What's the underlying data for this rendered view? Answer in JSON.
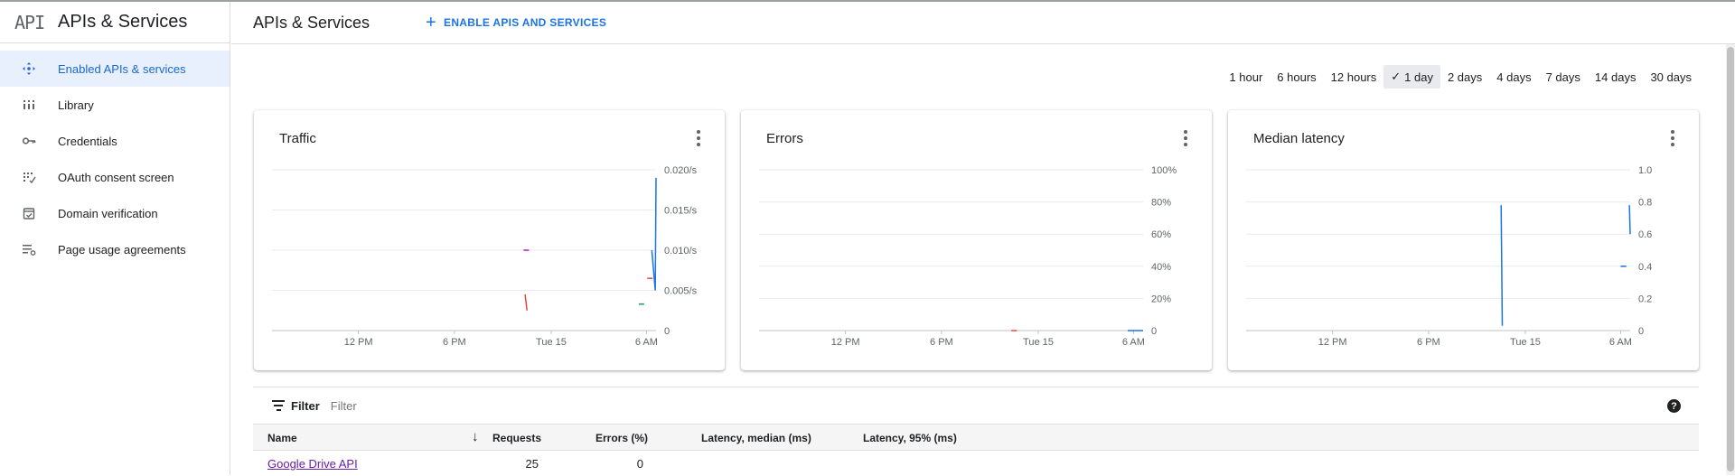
{
  "brand": {
    "logo": "API",
    "title": "APIs & Services"
  },
  "sidebar": {
    "items": [
      {
        "label": "Enabled APIs & services",
        "icon": "enabled-apis-icon",
        "active": true
      },
      {
        "label": "Library",
        "icon": "library-icon",
        "active": false
      },
      {
        "label": "Credentials",
        "icon": "key-icon",
        "active": false
      },
      {
        "label": "OAuth consent screen",
        "icon": "oauth-icon",
        "active": false
      },
      {
        "label": "Domain verification",
        "icon": "domain-check-icon",
        "active": false
      },
      {
        "label": "Page usage agreements",
        "icon": "settings-list-icon",
        "active": false
      }
    ]
  },
  "header": {
    "title": "APIs & Services",
    "enable_button": "ENABLE APIS AND SERVICES"
  },
  "time_range": {
    "options": [
      "1 hour",
      "6 hours",
      "12 hours",
      "1 day",
      "2 days",
      "4 days",
      "7 days",
      "14 days",
      "30 days"
    ],
    "selected": "1 day"
  },
  "cards": {
    "traffic": {
      "title": "Traffic"
    },
    "errors": {
      "title": "Errors"
    },
    "latency": {
      "title": "Median latency"
    }
  },
  "chart_data": [
    {
      "type": "line",
      "title": "Traffic",
      "categories": [
        "12 PM",
        "6 PM",
        "Tue 15",
        "6 AM"
      ],
      "y_ticks": [
        "0.020/s",
        "0.015/s",
        "0.010/s",
        "0.005/s",
        "0"
      ],
      "ylim": [
        0,
        0.02
      ],
      "grid": true,
      "series": [
        {
          "color": "#1a73e8",
          "points": [
            [
              0.989,
              0.01
            ],
            [
              0.998,
              0.005
            ],
            [
              1.0,
              0.019
            ]
          ]
        },
        {
          "color": "#ea4335",
          "points": [
            [
              0.659,
              0.0045
            ],
            [
              0.664,
              0.0025
            ]
          ]
        },
        {
          "color": "#ea4335",
          "points": [
            [
              0.984,
              0.0065
            ]
          ]
        },
        {
          "color": "#0f9d58",
          "points": [
            [
              0.962,
              0.0033
            ]
          ]
        },
        {
          "color": "#9c27b0",
          "points": [
            [
              0.662,
              0.01
            ]
          ]
        }
      ]
    },
    {
      "type": "line",
      "title": "Errors",
      "categories": [
        "12 PM",
        "6 PM",
        "Tue 15",
        "6 AM"
      ],
      "y_ticks": [
        "100%",
        "80%",
        "60%",
        "40%",
        "20%",
        "0"
      ],
      "ylim": [
        0,
        100
      ],
      "grid": true,
      "series": [
        {
          "color": "#1a73e8",
          "points": [
            [
              0.96,
              0
            ],
            [
              1.0,
              0
            ]
          ]
        },
        {
          "color": "#ea4335",
          "points": [
            [
              0.664,
              0
            ]
          ]
        }
      ]
    },
    {
      "type": "line",
      "title": "Median latency",
      "categories": [
        "12 PM",
        "6 PM",
        "Tue 15",
        "6 AM"
      ],
      "y_ticks": [
        "1.0",
        "0.8",
        "0.6",
        "0.4",
        "0.2",
        "0"
      ],
      "ylim": [
        0,
        1.0
      ],
      "grid": true,
      "series": [
        {
          "color": "#1a73e8",
          "points": [
            [
              0.664,
              0.78
            ],
            [
              0.667,
              0.03
            ]
          ]
        },
        {
          "color": "#1a73e8",
          "points": [
            [
              0.975,
              0.4
            ],
            [
              0.99,
              0.4
            ]
          ]
        },
        {
          "color": "#1a73e8",
          "points": [
            [
              0.998,
              0.78
            ],
            [
              1.0,
              0.6
            ]
          ]
        }
      ]
    }
  ],
  "table": {
    "filter_label": "Filter",
    "filter_placeholder": "Filter",
    "columns": [
      "Name",
      "Requests",
      "Errors (%)",
      "Latency, median (ms)",
      "Latency, 95% (ms)"
    ],
    "rows": [
      {
        "name": "Google Drive API",
        "requests": "25",
        "errors": "0",
        "latency_median": "",
        "latency_95": ""
      }
    ]
  }
}
